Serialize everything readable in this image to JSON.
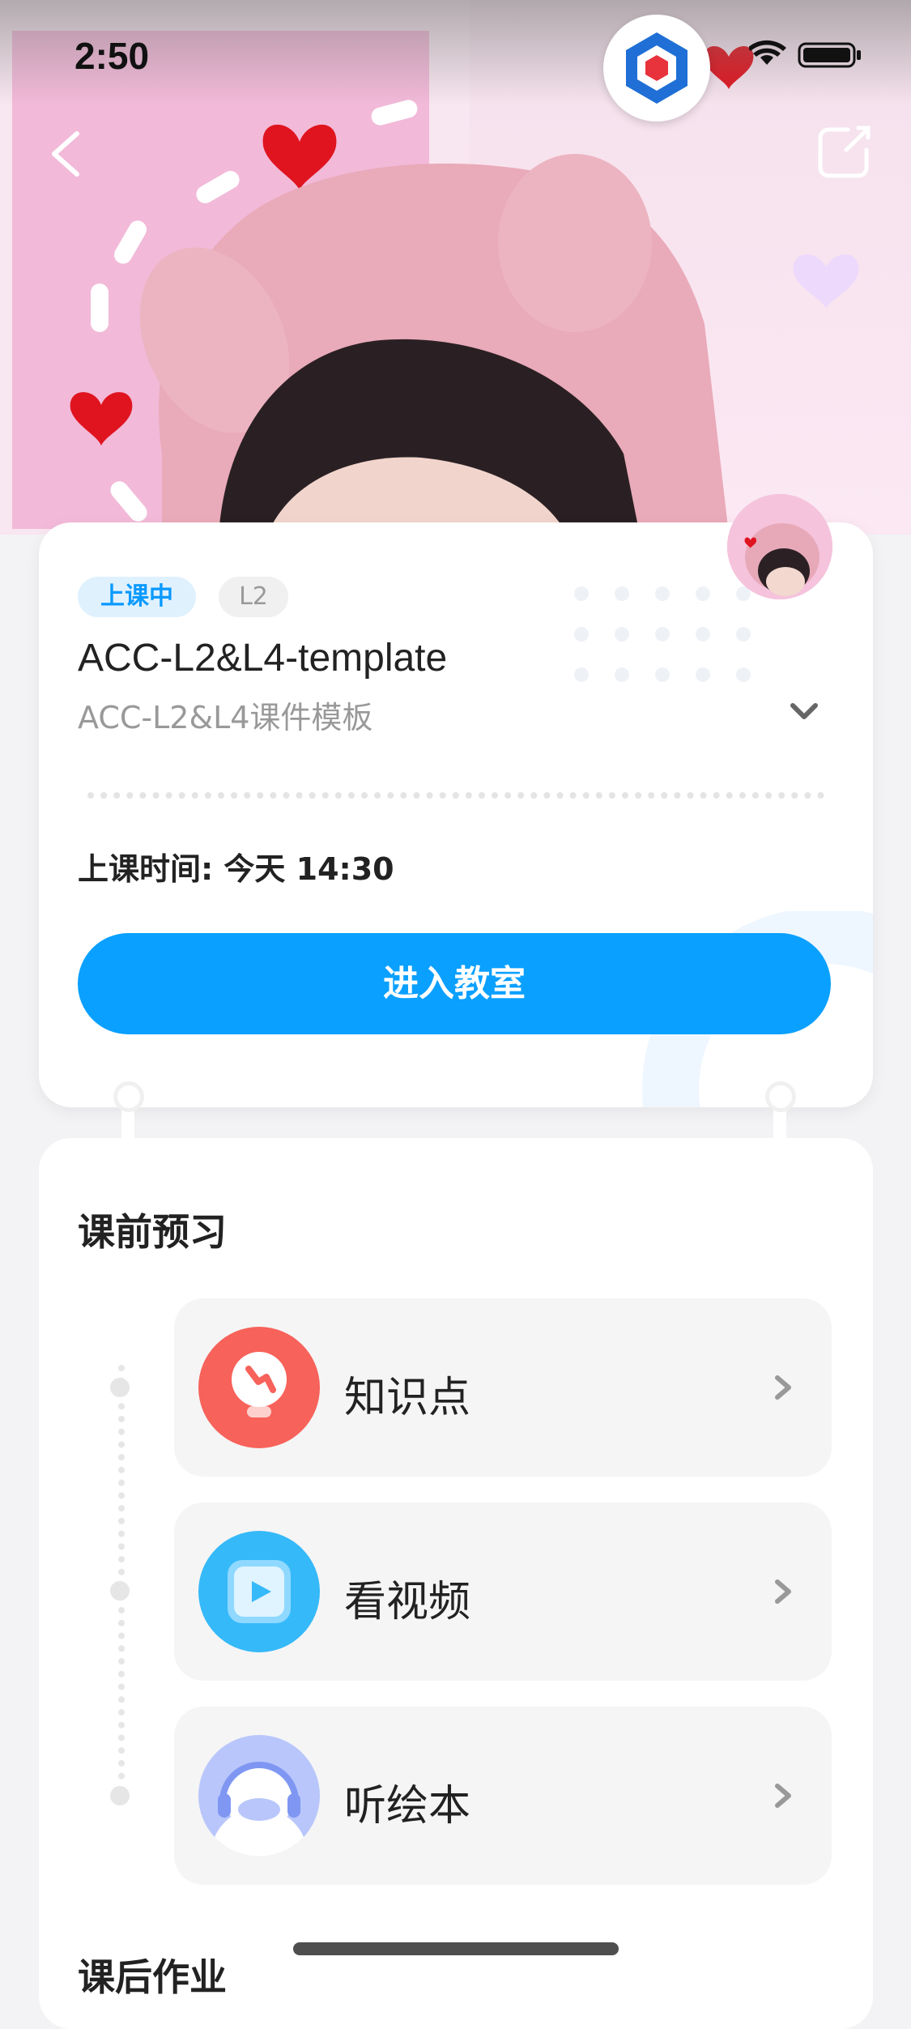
{
  "status_bar": {
    "time": "2:50"
  },
  "nav": {
    "back_icon": "chevron-left-icon",
    "share_icon": "share-icon"
  },
  "floating_app_icon": "hexagon-logo-icon",
  "course": {
    "status_tag": "上课中",
    "level_tag": "L2",
    "title": "ACC-L2&L4-template",
    "subtitle": "ACC-L2&L4课件模板",
    "time_label": "上课时间: 今天 14:30",
    "enter_button": "进入教室"
  },
  "preview": {
    "section_title": "课前预习",
    "items": [
      {
        "label": "知识点",
        "icon": "lightbulb-icon",
        "color": "#f7625a"
      },
      {
        "label": "看视频",
        "icon": "video-play-icon",
        "color": "#35b9f9"
      },
      {
        "label": "听绘本",
        "icon": "headphones-icon",
        "color": "#b8c6fb"
      }
    ]
  },
  "next_section_title": "课后作业"
}
